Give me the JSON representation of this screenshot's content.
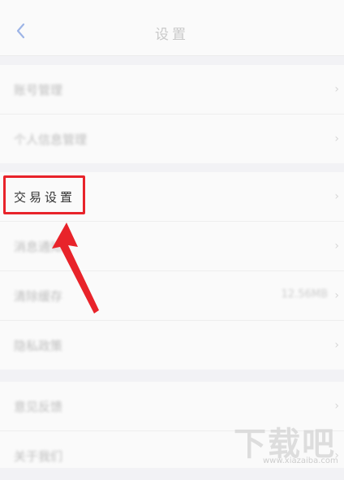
{
  "header": {
    "title": "设置"
  },
  "section1": {
    "items": [
      {
        "label": "账号管理"
      },
      {
        "label": "个人信息管理"
      }
    ]
  },
  "section2": {
    "items": [
      {
        "label": "交易设置"
      },
      {
        "label": "消息通知"
      },
      {
        "label": "清除缓存",
        "value": "12.56MB"
      },
      {
        "label": "隐私政策"
      }
    ]
  },
  "section3": {
    "items": [
      {
        "label": "意见反馈"
      },
      {
        "label": "关于我们"
      }
    ]
  },
  "watermark": {
    "text": "下载吧",
    "url": "www.xiazaiba.com"
  },
  "colors": {
    "highlight": "#e8232a",
    "back_icon": "#4f7cd8"
  }
}
